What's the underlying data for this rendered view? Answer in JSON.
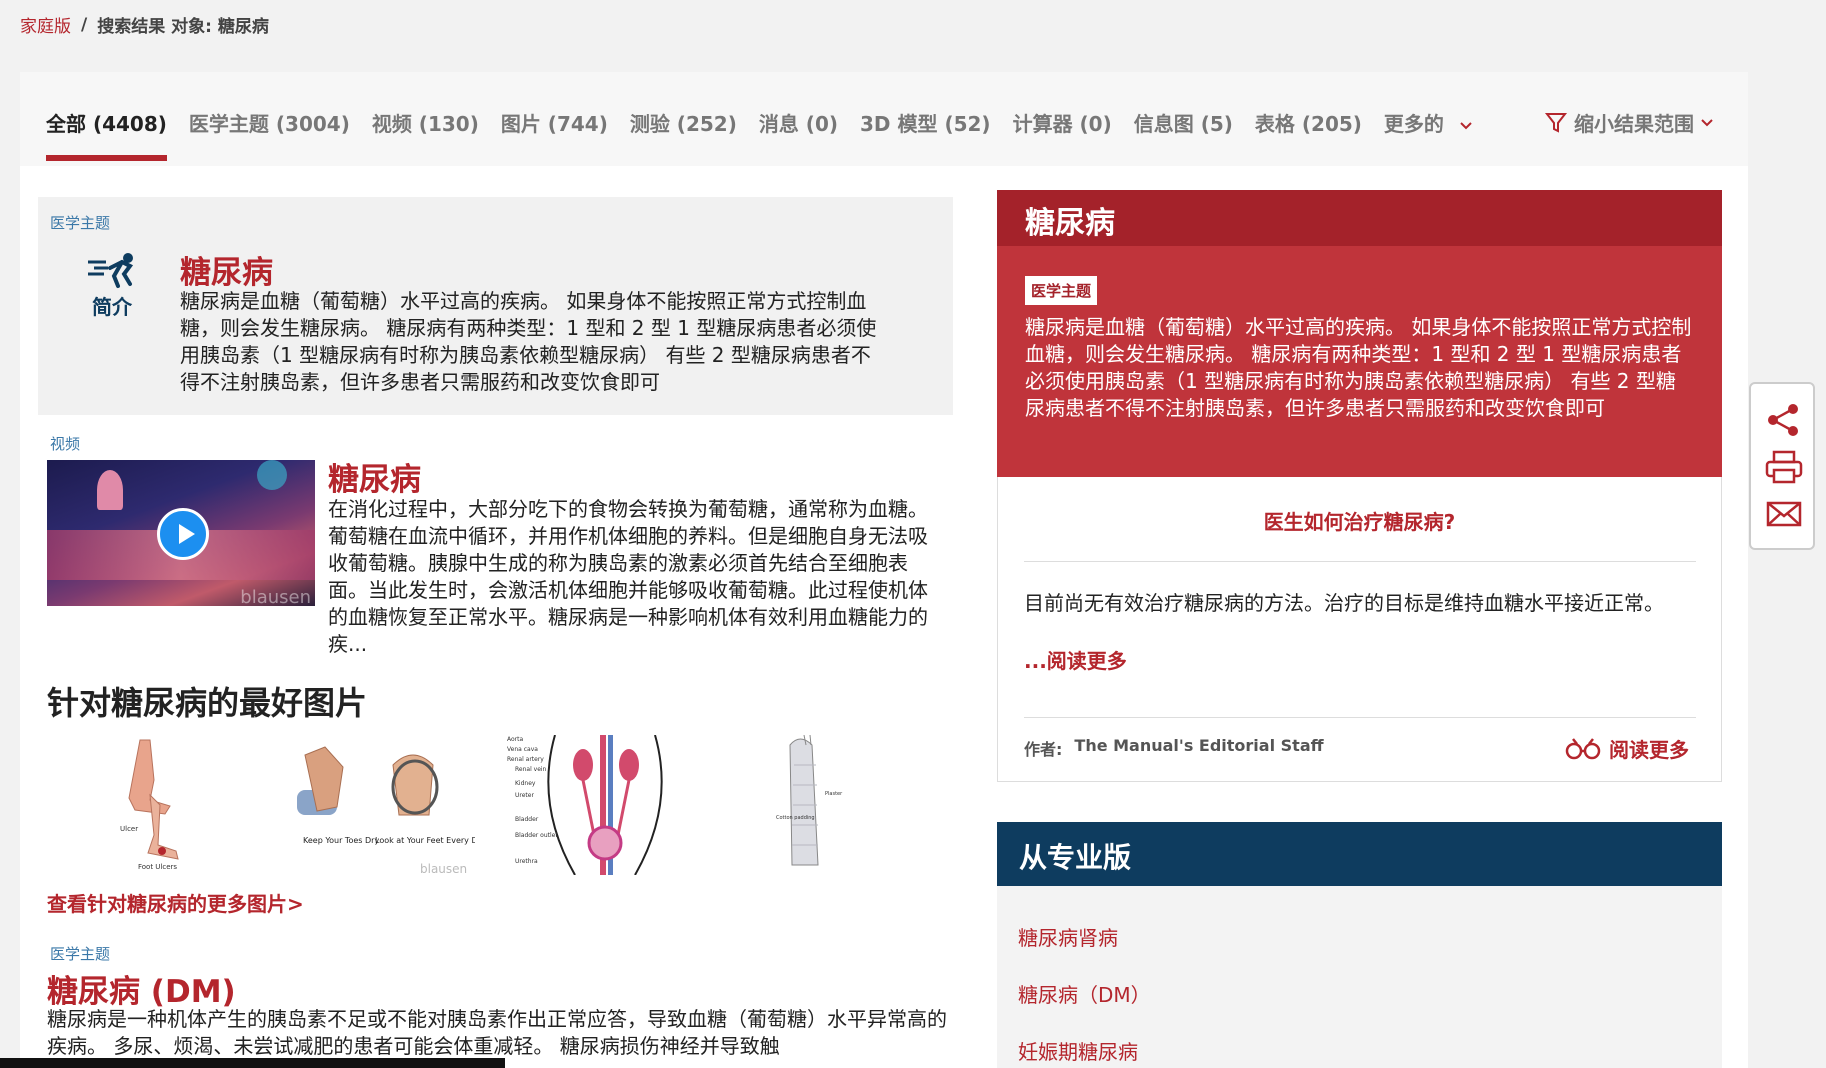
{
  "breadcrumb": {
    "home": "家庭版",
    "sep": "/",
    "current": "搜索结果 对象: 糖尿病"
  },
  "tabs": [
    {
      "label": "全部 (4408)"
    },
    {
      "label": "医学主题 (3004)"
    },
    {
      "label": "视频 (130)"
    },
    {
      "label": "图片 (744)"
    },
    {
      "label": "测验 (252)"
    },
    {
      "label": "消息 (0)"
    },
    {
      "label": "3D 模型 (52)"
    },
    {
      "label": "计算器 (0)"
    },
    {
      "label": "信息图 (5)"
    },
    {
      "label": "表格 (205)"
    },
    {
      "label": "更多的"
    }
  ],
  "narrow_label": "缩小结果范围",
  "result1": {
    "tag": "医学主题",
    "icon_label": "简介",
    "title": "糖尿病",
    "desc": "糖尿病是血糖（葡萄糖）水平过高的疾病。 如果身体不能按照正常方式控制血糖，则会发生糖尿病。 糖尿病有两种类型：1 型和 2 型 1 型糖尿病患者必须使用胰岛素（1 型糖尿病有时称为胰岛素依赖型糖尿病） 有些 2 型糖尿病患者不得不注射胰岛素，但许多患者只需服药和改变饮食即可"
  },
  "result2": {
    "tag": "视频",
    "title": "糖尿病",
    "watermark": "blausen",
    "desc": "在消化过程中，大部分吃下的食物会转换为葡萄糖，通常称为血糖。葡萄糖在血流中循环，并用作机体细胞的养料。但是细胞自身无法吸收葡萄糖。胰腺中生成的称为胰岛素的激素必须首先结合至细胞表面。当此发生时，会激活机体细胞并能够吸收葡萄糖。此过程使机体的血糖恢复至正常水平。糖尿病是一种影响机体有效利用血糖能力的疾..."
  },
  "images_section": {
    "heading": "针对糖尿病的最好图片",
    "more_link": "查看针对糖尿病的更多图片>",
    "img1_labels": {
      "ulcer": "Ulcer",
      "caption": "Foot Ulcers"
    },
    "img2_labels": {
      "left": "Keep Your\nToes Dry",
      "right": "Look at Your\nFeet Every Day",
      "wm": "blausen"
    },
    "img3_labels": [
      "Aorta",
      "Vena cava",
      "Renal artery",
      "Renal vein",
      "Kidney",
      "Ureter",
      "Bladder",
      "Bladder outlet",
      "Urethra"
    ],
    "img4_labels": {
      "top": "Plaster",
      "side": "Cotton padding"
    }
  },
  "result3": {
    "tag": "医学主题",
    "title": "糖尿病 (DM)",
    "desc": "糖尿病是一种机体产生的胰岛素不足或不能对胰岛素作出正常应答，导致血糖（葡萄糖）水平异常高的疾病。 多尿、烦渴、未尝试减肥的患者可能会体重减轻。 糖尿病损伤神经并导致触"
  },
  "right_card": {
    "title": "糖尿病",
    "tag": "医学主题",
    "desc": "糖尿病是血糖（葡萄糖）水平过高的疾病。 如果身体不能按照正常方式控制血糖，则会发生糖尿病。 糖尿病有两种类型：1 型和 2 型 1 型糖尿病患者必须使用胰岛素（1 型糖尿病有时称为胰岛素依赖型糖尿病） 有些 2 型糖尿病患者不得不注射胰岛素，但许多患者只需服药和改变饮食即可",
    "question": "医生如何治疗糖尿病?",
    "answer": "目前尚无有效治疗糖尿病的方法。治疗的目标是维持血糖水平接近正常。",
    "read_more_inline": "...阅读更多",
    "author_label": "作者:",
    "author_name": "The Manual's Editorial Staff",
    "read_more": "阅读更多"
  },
  "pro": {
    "title": "从专业版",
    "links": [
      "糖尿病肾病",
      "糖尿病（DM）",
      "妊娠期糖尿病"
    ]
  },
  "colors": {
    "brand_red": "#b4262d",
    "dark_red": "#a4222a",
    "navy": "#0e3c5f",
    "tag_blue": "#3b78a8"
  }
}
